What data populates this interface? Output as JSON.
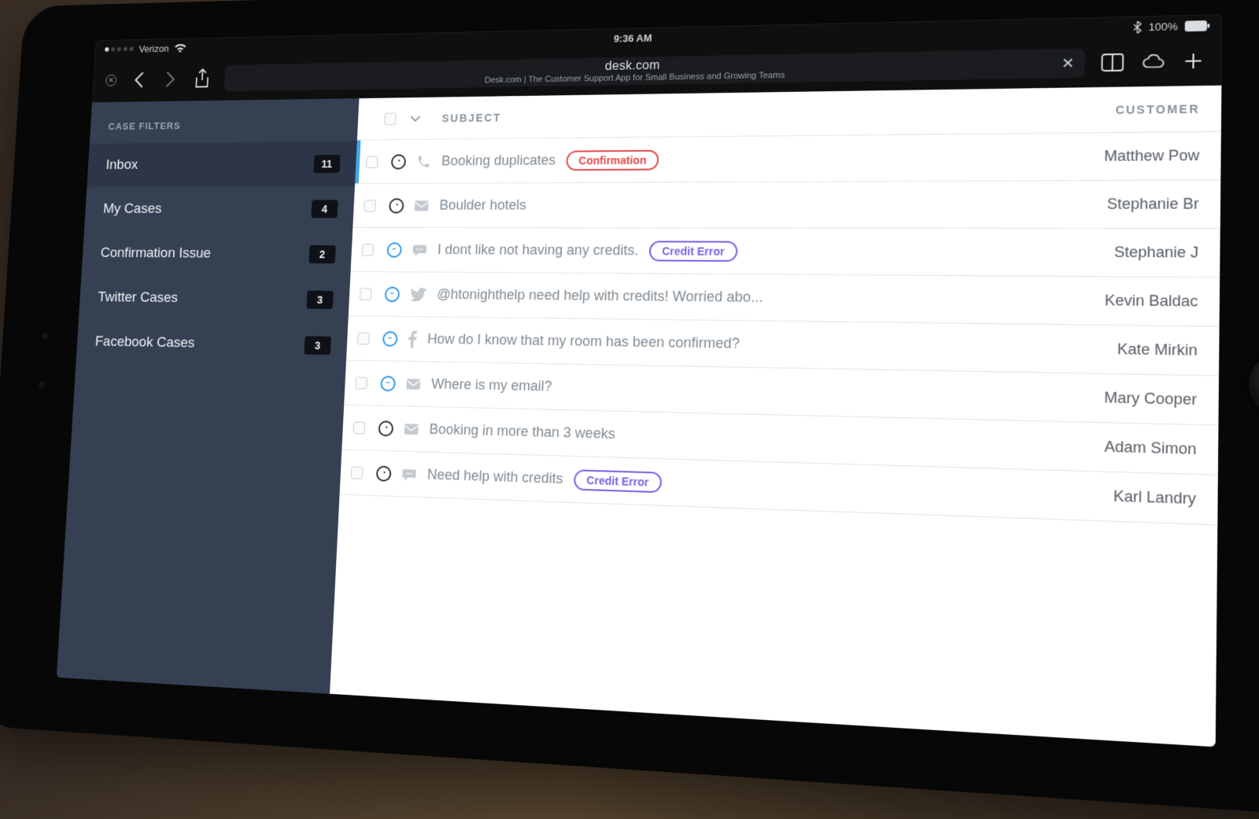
{
  "statusbar": {
    "carrier": "Verizon",
    "time": "9:36 AM",
    "battery_pct": "100%"
  },
  "browser": {
    "domain": "desk.com",
    "page_title": "Desk.com | The Customer Support App for Small Business and Growing Teams"
  },
  "sidebar": {
    "title": "CASE FILTERS",
    "filters": [
      {
        "label": "Inbox",
        "count": "11"
      },
      {
        "label": "My Cases",
        "count": "4"
      },
      {
        "label": "Confirmation Issue",
        "count": "2"
      },
      {
        "label": "Twitter Cases",
        "count": "3"
      },
      {
        "label": "Facebook Cases",
        "count": "3"
      }
    ]
  },
  "list": {
    "header": {
      "subject": "SUBJECT",
      "customer": "CUSTOMER"
    },
    "rows": [
      {
        "status": "dark",
        "channel": "phone",
        "subject": "Booking duplicates",
        "tag": {
          "text": "Confirmation",
          "color": "red"
        },
        "customer": "Matthew Pow"
      },
      {
        "status": "dark",
        "channel": "email",
        "subject": "Boulder hotels",
        "tag": null,
        "customer": "Stephanie Br"
      },
      {
        "status": "blue",
        "channel": "chat",
        "subject": "I dont like not having any credits.",
        "tag": {
          "text": "Credit Error",
          "color": "purple"
        },
        "customer": "Stephanie J"
      },
      {
        "status": "blue",
        "channel": "twitter",
        "subject": "@htonighthelp need help with credits! Worried abo...",
        "tag": null,
        "customer": "Kevin Baldac"
      },
      {
        "status": "blue",
        "channel": "facebook",
        "subject": "How do I know that my room has been confirmed?",
        "tag": null,
        "customer": "Kate Mirkin"
      },
      {
        "status": "blue",
        "channel": "email",
        "subject": "Where is my email?",
        "tag": null,
        "customer": "Mary Cooper"
      },
      {
        "status": "dark",
        "channel": "email",
        "subject": "Booking in more than 3 weeks",
        "tag": null,
        "customer": "Adam Simon"
      },
      {
        "status": "dark",
        "channel": "chat",
        "subject": "Need help with credits",
        "tag": {
          "text": "Credit Error",
          "color": "purple"
        },
        "customer": "Karl Landry"
      }
    ]
  }
}
